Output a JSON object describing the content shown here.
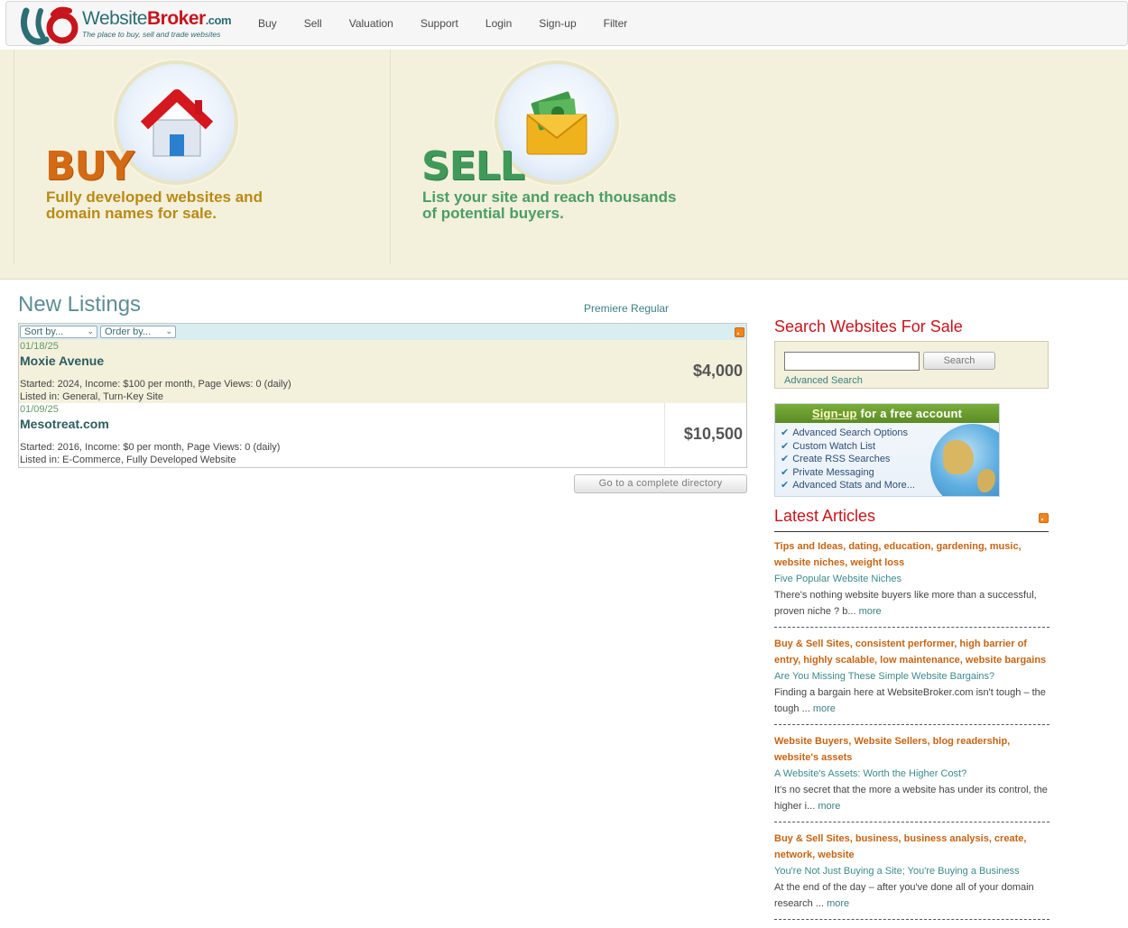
{
  "header": {
    "logo": {
      "part1": "Website",
      "part2": "Broker",
      "part3": ".com",
      "tagline": "The place to buy, sell and trade websites"
    },
    "nav": [
      "Buy",
      "Sell",
      "Valuation",
      "Support",
      "Login",
      "Sign-up",
      "Filter"
    ]
  },
  "hero": {
    "buy": {
      "title": "BUY",
      "line1": "Fully developed websites and",
      "line2": "domain names for sale."
    },
    "sell": {
      "title": "SELL",
      "line1": "List your site and reach thousands",
      "line2": "of potential buyers."
    }
  },
  "listings": {
    "title": "New Listings",
    "tabs": {
      "premiere": "Premiere",
      "regular": "Regular"
    },
    "sort_label": "Sort by...",
    "order_label": "Order by...",
    "items": [
      {
        "date": "01/18/25",
        "title": "Moxie Avenue",
        "meta": "Started: 2024, Income: $100 per month, Page Views: 0 (daily)",
        "listed": "Listed in: General, Turn-Key Site",
        "price": "$4,000"
      },
      {
        "date": "01/09/25",
        "title": "Mesotreat.com",
        "meta": "Started: 2016, Income: $0 per month, Page Views: 0 (daily)",
        "listed": "Listed in: E-Commerce, Fully Developed Website",
        "price": "$10,500"
      }
    ],
    "directory_button": "Go to a complete directory"
  },
  "search": {
    "title": "Search Websites For Sale",
    "input_value": "",
    "button": "Search",
    "advanced": "Advanced Search"
  },
  "signup": {
    "link": "Sign-up",
    "rest": " for a free account",
    "features": [
      "Advanced Search Options",
      "Custom Watch List",
      "Create RSS Searches",
      "Private Messaging",
      "Advanced Stats and More..."
    ]
  },
  "articles": {
    "title": "Latest Articles",
    "more_label": "more",
    "items": [
      {
        "tags": "Tips and Ideas, dating, education, gardening, music, website niches, weight loss",
        "title": "Five Popular Website Niches",
        "excerpt": "There's nothing website buyers like more than a successful, proven niche ? b... "
      },
      {
        "tags": "Buy & Sell Sites, consistent performer, high barrier of entry, highly scalable, low maintenance, website bargains",
        "title": "Are You Missing These Simple Website Bargains?",
        "excerpt": "Finding a bargain here at WebsiteBroker.com isn't tough – the tough ... "
      },
      {
        "tags": "Website Buyers, Website Sellers, blog readership, website's assets",
        "title": "A Website's Assets: Worth the Higher Cost?",
        "excerpt": "It's no secret that the more a website has under its control, the higher i... "
      },
      {
        "tags": "Buy & Sell Sites, business, business analysis, create, network, website",
        "title": "You're Not Just Buying a Site; You're Buying a Business",
        "excerpt": "At the end of the day – after you've done all of your domain research ... "
      }
    ]
  },
  "colors": {
    "accent": "#c8141c",
    "teal": "#2c6e74",
    "hero_bg": "#f3f0dc"
  }
}
